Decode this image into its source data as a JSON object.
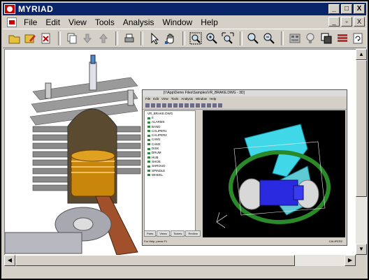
{
  "window": {
    "title": "MYRIAD",
    "controls": {
      "minimize": "_",
      "maximize": "□",
      "close": "X"
    }
  },
  "menubar": {
    "items": [
      "File",
      "Edit",
      "View",
      "Tools",
      "Analysis",
      "Window",
      "Help"
    ],
    "doc_controls": {
      "minimize": "_",
      "restore": "▫",
      "close": "X"
    }
  },
  "toolbar": {
    "tools": [
      "open-folder-icon",
      "edit-icon",
      "close-doc-icon",
      "copy-icon",
      "arrow-down-icon",
      "arrow-up-icon",
      "print-icon",
      "pointer-icon",
      "hand-icon",
      "zoom-extent-icon",
      "zoom-in-icon",
      "zoom-window-icon",
      "zoom-icon",
      "zoom-out-icon",
      "view-icon",
      "lightbulb-icon",
      "layers-icon",
      "stack-icon",
      "refresh-icon"
    ]
  },
  "inner_window": {
    "title": "[I:\\App\\Demo Files\\Samples\\VR_BRAKE.DWG - 3D]",
    "menu": [
      "File",
      "Edit",
      "View",
      "Tools",
      "Analysis",
      "Window",
      "Help"
    ],
    "tree_root": "VR_BRAKE.DWG",
    "tree_items": [
      "0",
      "ALARMS",
      "BAND",
      "CALIPER1",
      "CALIPER2",
      "CAM1",
      "CAM2",
      "DISK",
      "DRUM",
      "HUB",
      "SHOE",
      "SHROUD",
      "SPINDLE",
      "WHEEL"
    ],
    "tabs": [
      "Parts",
      "Views",
      "Tickets",
      "Redline"
    ],
    "status_left": "For Help, press F1",
    "status_right": "CALIPER2"
  },
  "colors": {
    "titlebar": "#0a246a",
    "chrome": "#d4d0c8",
    "viewport": "#000000",
    "piston": "#c8860a",
    "caliper": "#2a2ae0",
    "bracket": "#40d8e8"
  }
}
